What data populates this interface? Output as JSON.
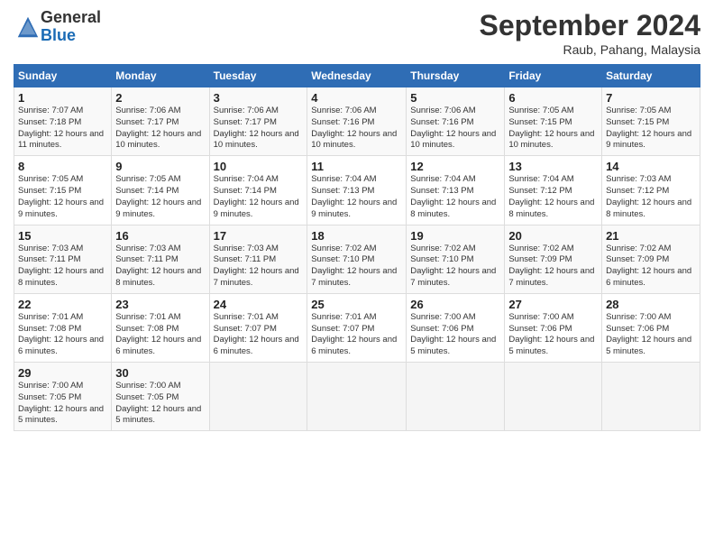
{
  "logo": {
    "general": "General",
    "blue": "Blue"
  },
  "header": {
    "title": "September 2024",
    "subtitle": "Raub, Pahang, Malaysia"
  },
  "days_of_week": [
    "Sunday",
    "Monday",
    "Tuesday",
    "Wednesday",
    "Thursday",
    "Friday",
    "Saturday"
  ],
  "weeks": [
    [
      {
        "day": "1",
        "info": "Sunrise: 7:07 AM\nSunset: 7:18 PM\nDaylight: 12 hours and 11 minutes."
      },
      {
        "day": "2",
        "info": "Sunrise: 7:06 AM\nSunset: 7:17 PM\nDaylight: 12 hours and 10 minutes."
      },
      {
        "day": "3",
        "info": "Sunrise: 7:06 AM\nSunset: 7:17 PM\nDaylight: 12 hours and 10 minutes."
      },
      {
        "day": "4",
        "info": "Sunrise: 7:06 AM\nSunset: 7:16 PM\nDaylight: 12 hours and 10 minutes."
      },
      {
        "day": "5",
        "info": "Sunrise: 7:06 AM\nSunset: 7:16 PM\nDaylight: 12 hours and 10 minutes."
      },
      {
        "day": "6",
        "info": "Sunrise: 7:05 AM\nSunset: 7:15 PM\nDaylight: 12 hours and 10 minutes."
      },
      {
        "day": "7",
        "info": "Sunrise: 7:05 AM\nSunset: 7:15 PM\nDaylight: 12 hours and 9 minutes."
      }
    ],
    [
      {
        "day": "8",
        "info": "Sunrise: 7:05 AM\nSunset: 7:15 PM\nDaylight: 12 hours and 9 minutes."
      },
      {
        "day": "9",
        "info": "Sunrise: 7:05 AM\nSunset: 7:14 PM\nDaylight: 12 hours and 9 minutes."
      },
      {
        "day": "10",
        "info": "Sunrise: 7:04 AM\nSunset: 7:14 PM\nDaylight: 12 hours and 9 minutes."
      },
      {
        "day": "11",
        "info": "Sunrise: 7:04 AM\nSunset: 7:13 PM\nDaylight: 12 hours and 9 minutes."
      },
      {
        "day": "12",
        "info": "Sunrise: 7:04 AM\nSunset: 7:13 PM\nDaylight: 12 hours and 8 minutes."
      },
      {
        "day": "13",
        "info": "Sunrise: 7:04 AM\nSunset: 7:12 PM\nDaylight: 12 hours and 8 minutes."
      },
      {
        "day": "14",
        "info": "Sunrise: 7:03 AM\nSunset: 7:12 PM\nDaylight: 12 hours and 8 minutes."
      }
    ],
    [
      {
        "day": "15",
        "info": "Sunrise: 7:03 AM\nSunset: 7:11 PM\nDaylight: 12 hours and 8 minutes."
      },
      {
        "day": "16",
        "info": "Sunrise: 7:03 AM\nSunset: 7:11 PM\nDaylight: 12 hours and 8 minutes."
      },
      {
        "day": "17",
        "info": "Sunrise: 7:03 AM\nSunset: 7:11 PM\nDaylight: 12 hours and 7 minutes."
      },
      {
        "day": "18",
        "info": "Sunrise: 7:02 AM\nSunset: 7:10 PM\nDaylight: 12 hours and 7 minutes."
      },
      {
        "day": "19",
        "info": "Sunrise: 7:02 AM\nSunset: 7:10 PM\nDaylight: 12 hours and 7 minutes."
      },
      {
        "day": "20",
        "info": "Sunrise: 7:02 AM\nSunset: 7:09 PM\nDaylight: 12 hours and 7 minutes."
      },
      {
        "day": "21",
        "info": "Sunrise: 7:02 AM\nSunset: 7:09 PM\nDaylight: 12 hours and 6 minutes."
      }
    ],
    [
      {
        "day": "22",
        "info": "Sunrise: 7:01 AM\nSunset: 7:08 PM\nDaylight: 12 hours and 6 minutes."
      },
      {
        "day": "23",
        "info": "Sunrise: 7:01 AM\nSunset: 7:08 PM\nDaylight: 12 hours and 6 minutes."
      },
      {
        "day": "24",
        "info": "Sunrise: 7:01 AM\nSunset: 7:07 PM\nDaylight: 12 hours and 6 minutes."
      },
      {
        "day": "25",
        "info": "Sunrise: 7:01 AM\nSunset: 7:07 PM\nDaylight: 12 hours and 6 minutes."
      },
      {
        "day": "26",
        "info": "Sunrise: 7:00 AM\nSunset: 7:06 PM\nDaylight: 12 hours and 5 minutes."
      },
      {
        "day": "27",
        "info": "Sunrise: 7:00 AM\nSunset: 7:06 PM\nDaylight: 12 hours and 5 minutes."
      },
      {
        "day": "28",
        "info": "Sunrise: 7:00 AM\nSunset: 7:06 PM\nDaylight: 12 hours and 5 minutes."
      }
    ],
    [
      {
        "day": "29",
        "info": "Sunrise: 7:00 AM\nSunset: 7:05 PM\nDaylight: 12 hours and 5 minutes."
      },
      {
        "day": "30",
        "info": "Sunrise: 7:00 AM\nSunset: 7:05 PM\nDaylight: 12 hours and 5 minutes."
      },
      {
        "day": "",
        "info": ""
      },
      {
        "day": "",
        "info": ""
      },
      {
        "day": "",
        "info": ""
      },
      {
        "day": "",
        "info": ""
      },
      {
        "day": "",
        "info": ""
      }
    ]
  ]
}
